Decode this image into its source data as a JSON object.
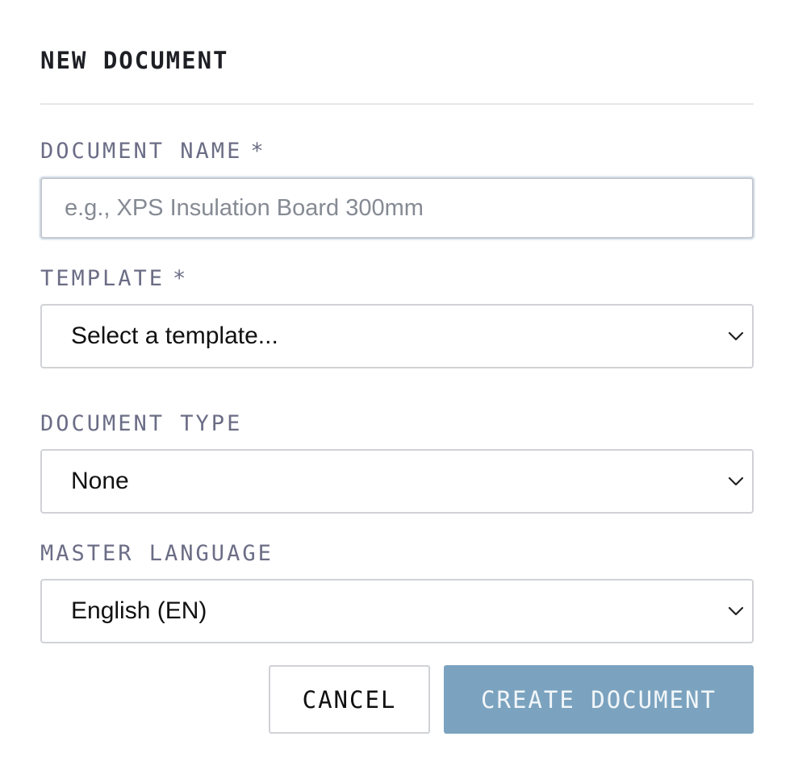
{
  "dialog": {
    "title": "NEW DOCUMENT"
  },
  "fields": {
    "document_name": {
      "label": "DOCUMENT NAME",
      "required_marker": "*",
      "placeholder": "e.g., XPS Insulation Board 300mm",
      "value": ""
    },
    "template": {
      "label": "TEMPLATE",
      "required_marker": "*",
      "selected": "Select a template..."
    },
    "document_type": {
      "label": "DOCUMENT TYPE",
      "selected": "None"
    },
    "master_language": {
      "label": "MASTER LANGUAGE",
      "selected": "English (EN)"
    }
  },
  "actions": {
    "cancel_label": "CANCEL",
    "create_label": "CREATE DOCUMENT"
  },
  "icons": {
    "select_chevron": "chevron-down-icon"
  },
  "colors": {
    "primary_button": "#7ba3bf",
    "label_text": "#6b6d86"
  }
}
